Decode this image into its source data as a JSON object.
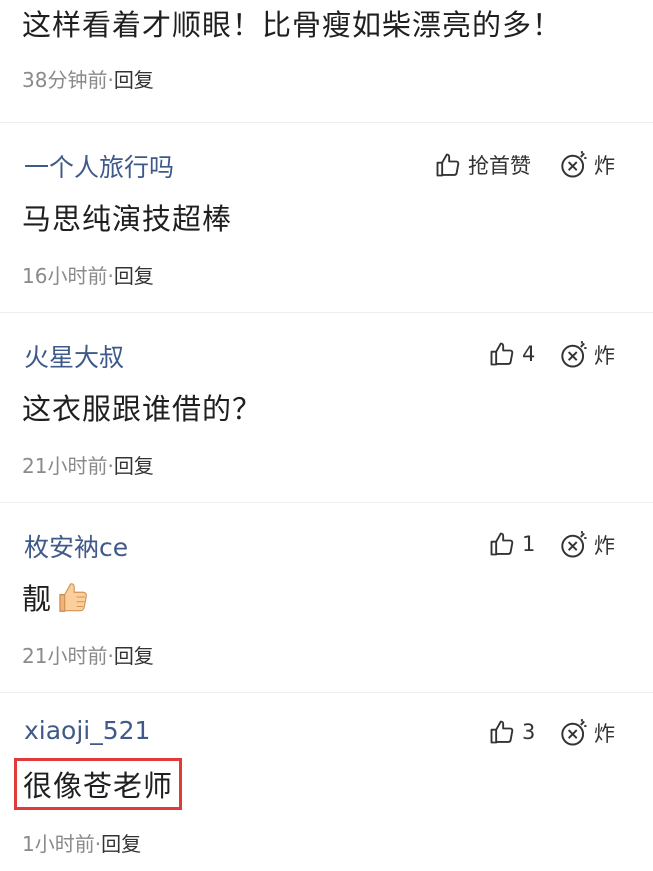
{
  "first_comment": {
    "text": "这样看着才顺眼！比骨瘦如柴漂亮的多！",
    "time": "38分钟前",
    "reply": "回复"
  },
  "comments": [
    {
      "username": "一个人旅行吗",
      "like_label": "抢首赞",
      "bomb_label": "炸",
      "text": "马思纯演技超棒",
      "time": "16小时前",
      "reply": "回复"
    },
    {
      "username": "火星大叔",
      "like_label": "4",
      "bomb_label": "炸",
      "text": "这衣服跟谁借的？",
      "time": "21小时前",
      "reply": "回复"
    },
    {
      "username": "枚安衲ce",
      "like_label": "1",
      "bomb_label": "炸",
      "text": "靓",
      "emoji": "thumbs-up",
      "time": "21小时前",
      "reply": "回复"
    },
    {
      "username": "xiaoji_521",
      "like_label": "3",
      "bomb_label": "炸",
      "text": "很像苍老师",
      "highlighted": true,
      "time": "1小时前",
      "reply": "回复"
    }
  ],
  "separator": "·",
  "colors": {
    "username": "#3f5a8a",
    "meta": "#8a8a8a",
    "highlight_border": "#e03a3a"
  },
  "icons": {
    "like": "thumbs-up-outline-icon",
    "bomb": "bomb-icon"
  }
}
